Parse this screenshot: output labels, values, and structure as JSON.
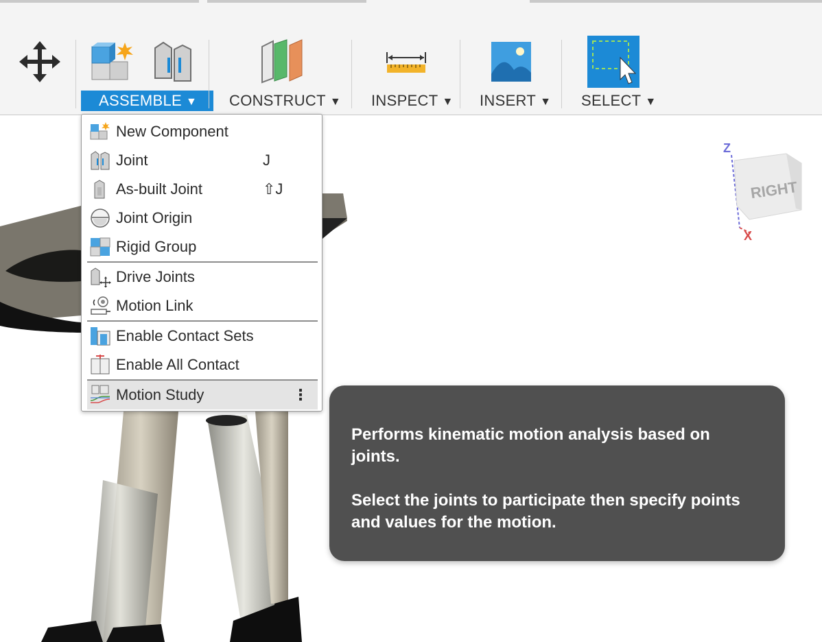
{
  "toolbar": {
    "groups": [
      {
        "label": "ASSEMBLE",
        "icon": "new-component-icon",
        "active": true
      },
      {
        "label": "CONSTRUCT",
        "icon": "construct-plane-icon"
      },
      {
        "label": "INSPECT",
        "icon": "measure-icon"
      },
      {
        "label": "INSERT",
        "icon": "insert-image-icon"
      },
      {
        "label": "SELECT",
        "icon": "select-window-icon"
      }
    ]
  },
  "assemble_menu": {
    "items": [
      {
        "label": "New Component",
        "shortcut": ""
      },
      {
        "label": "Joint",
        "shortcut": "J"
      },
      {
        "label": "As-built Joint",
        "shortcut": "⇧J"
      },
      {
        "label": "Joint Origin",
        "shortcut": ""
      },
      {
        "label": "Rigid Group",
        "shortcut": ""
      },
      {
        "label": "Drive Joints",
        "shortcut": ""
      },
      {
        "label": "Motion Link",
        "shortcut": ""
      },
      {
        "label": "Enable Contact Sets",
        "shortcut": ""
      },
      {
        "label": "Enable All Contact",
        "shortcut": ""
      },
      {
        "label": "Motion Study",
        "shortcut": "",
        "highlighted": true
      }
    ]
  },
  "tooltip": {
    "line1": "Performs kinematic motion analysis based on joints.",
    "line2": "Select the joints to participate then specify points and values for the motion."
  },
  "viewcube": {
    "face_label": "RIGHT",
    "axis_z": "Z",
    "axis_x": "X"
  },
  "colors": {
    "accent": "#1c8ad6",
    "tooltip_bg": "#505050",
    "toolbar_bg": "#f4f4f4"
  }
}
